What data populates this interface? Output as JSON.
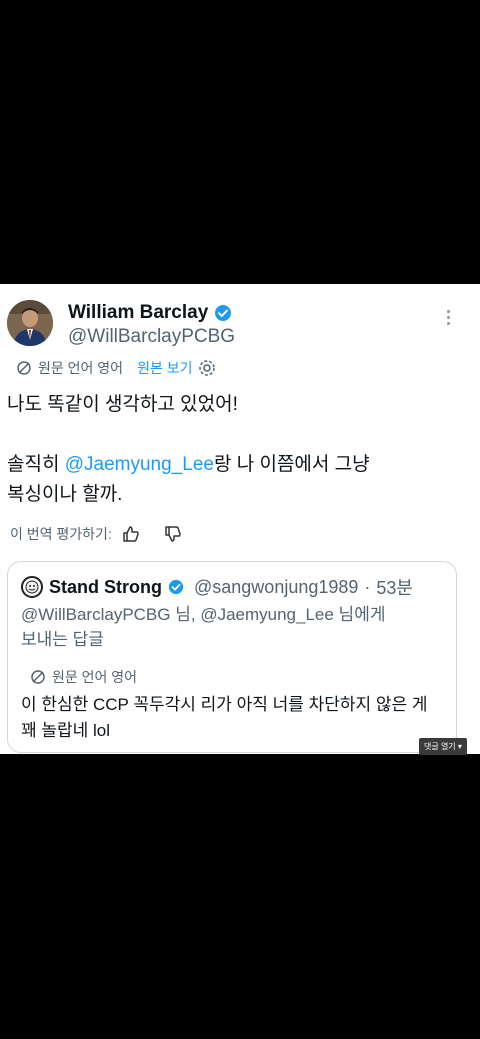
{
  "tweet": {
    "author_name": "William Barclay",
    "author_handle": "@WillBarclayPCBG",
    "translation_label": "원문 언어 영어",
    "show_original_label": "원본 보기",
    "line1": "나도 똑같이 생각하고 있었어!",
    "line2_pre": "솔직히 ",
    "line2_mention": "@Jaemyung_Lee",
    "line2_post": "랑 나 이쯤에서 그냥",
    "line3": "복싱이나 할까.",
    "rate_label": "이 번역 평가하기:"
  },
  "quote": {
    "author_name": "Stand Strong",
    "author_handle": "@sangwonjung1989",
    "separator": "·",
    "time": "53분",
    "reply_mention1": "@WillBarclayPCBG",
    "reply_mid": " 님, ",
    "reply_mention2": "@Jaemyung_Lee",
    "reply_post": " 님에게",
    "reply_line2": "보내는 답글",
    "translation_label": "원문 언어 영어",
    "text_line1": "이 한심한 CCP 꼭두각시 리가 아직 너를 차단하지 않은 게",
    "text_line2": "꽤 놀랍네 lol"
  },
  "overlay": {
    "button_label": "댓글 열기 ▾"
  },
  "colors": {
    "accent": "#1d9bf0",
    "verified": "#1d9bf0",
    "muted": "#536471"
  }
}
